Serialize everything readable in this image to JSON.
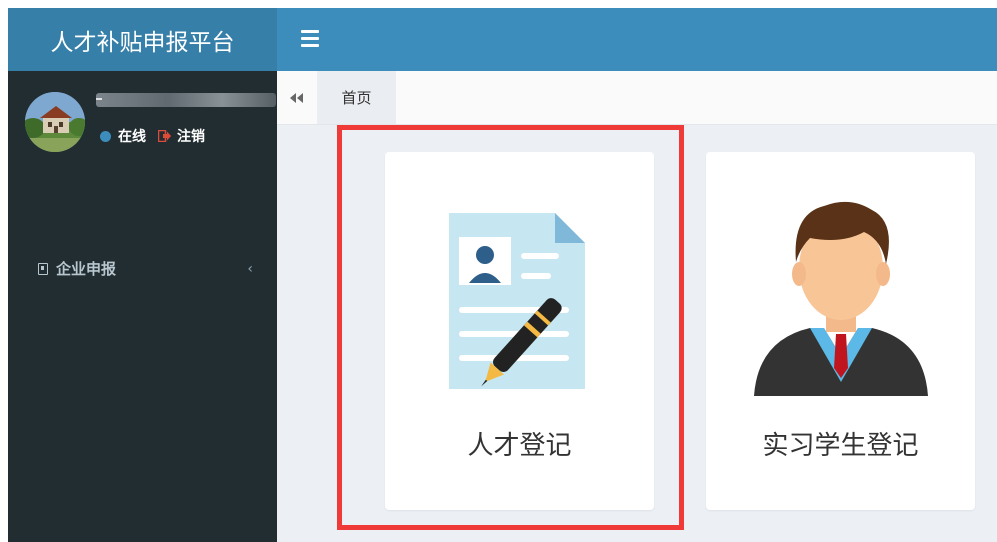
{
  "header": {
    "app_title": "人才补贴申报平台",
    "menu_toggle_icon": "hamburger-icon"
  },
  "sidebar": {
    "user": {
      "name_placeholder": "-",
      "status_online": "在线",
      "logout_label": "注销"
    },
    "items": [
      {
        "label": "企业申报",
        "icon": "user-card-icon"
      }
    ]
  },
  "tabs": {
    "back_icon": "double-chevron-left-icon",
    "items": [
      {
        "label": "首页",
        "active": true
      }
    ]
  },
  "cards": [
    {
      "label": "人才登记",
      "icon": "resume-pen-icon"
    },
    {
      "label": "实习学生登记",
      "icon": "graduate-student-icon"
    }
  ],
  "colors": {
    "header_dark": "#367fa9",
    "header": "#3c8dbc",
    "sidebar": "#222d32",
    "content_bg": "#ecf0f5",
    "highlight": "#f03a37",
    "online_dot": "#3c8dbc",
    "logout_icon": "#dd4b39"
  }
}
